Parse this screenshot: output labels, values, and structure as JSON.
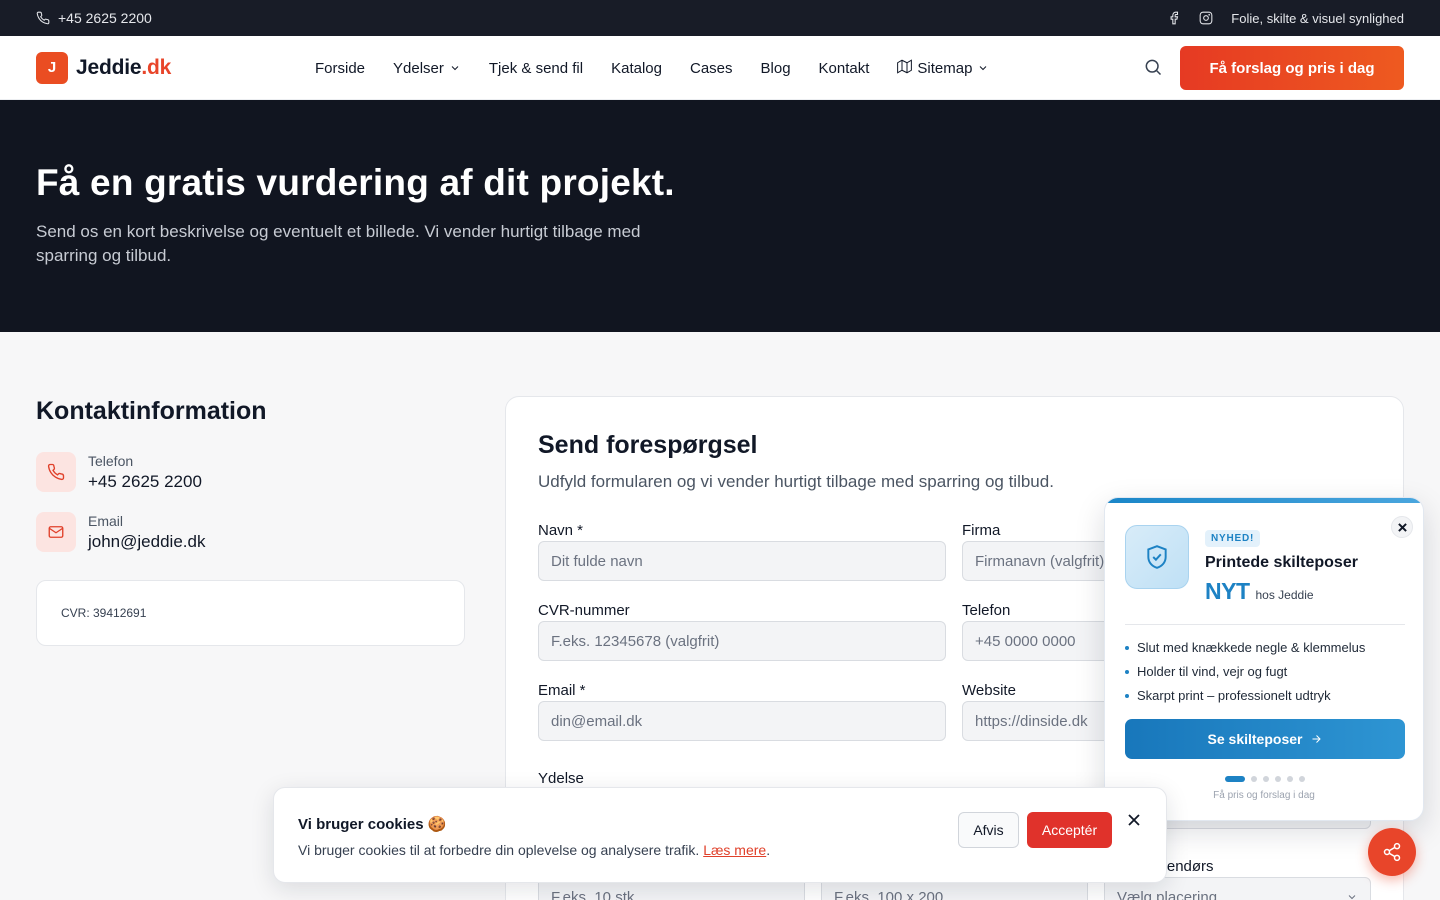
{
  "topbar": {
    "phone": "+45 2625 2200",
    "tagline": "Folie, skilte & visuel synlighed"
  },
  "header": {
    "logo_mark": "J",
    "logo_name": "Jeddie",
    "logo_tld": ".dk",
    "nav": {
      "forside": "Forside",
      "ydelser": "Ydelser",
      "tjek": "Tjek & send fil",
      "katalog": "Katalog",
      "cases": "Cases",
      "blog": "Blog",
      "kontakt": "Kontakt",
      "sitemap": "Sitemap"
    },
    "cta": "Få forslag og pris i dag"
  },
  "hero": {
    "title": "Få en gratis vurdering af dit projekt.",
    "subtitle": "Send os en kort beskrivelse og eventuelt et billede. Vi vender hurtigt tilbage med sparring og tilbud."
  },
  "contact_info": {
    "title": "Kontaktinformation",
    "phone_label": "Telefon",
    "phone_value": "+45 2625 2200",
    "email_label": "Email",
    "email_value": "john@jeddie.dk",
    "cvr": "CVR: 39412691"
  },
  "form": {
    "title": "Send forespørgsel",
    "subtitle": "Udfyld formularen og vi vender hurtigt tilbage med sparring og tilbud.",
    "name_label": "Navn *",
    "name_placeholder": "Dit fulde navn",
    "company_label": "Firma",
    "company_placeholder": "Firmanavn (valgfrit)",
    "cvr_label": "CVR-nummer",
    "cvr_placeholder": "F.eks. 12345678 (valgfrit)",
    "phone_label": "Telefon",
    "phone_placeholder": "+45 0000 0000",
    "email_label": "Email *",
    "email_placeholder": "din@email.dk",
    "website_label": "Website",
    "website_placeholder": "https://dinside.dk",
    "service_label": "Ydelse",
    "placement_label_partial": "r udendørs",
    "quantity_placeholder": "F.eks. 10 stk",
    "size_placeholder": "F.eks. 100 x 200",
    "placement_placeholder": "Vælg placering"
  },
  "promo": {
    "badge": "NYHED!",
    "title": "Printede skilteposer",
    "nyt": "NYT",
    "nyt_suffix": "hos Jeddie",
    "bullets": [
      "Slut med knækkede negle & klemmelus",
      "Holder til vind, vejr og fugt",
      "Skarpt print – professionelt udtryk"
    ],
    "button": "Se skilteposer",
    "footer": "Få pris og forslag i dag",
    "active_slide": 1,
    "slide_count": 6
  },
  "cookie": {
    "title": "Vi bruger cookies 🍪",
    "text": "Vi bruger cookies til at forbedre din oplevelse og analysere trafik.",
    "link": "Læs mere",
    "link_suffix": ".",
    "decline": "Afvis",
    "accept": "Acceptér"
  },
  "icons": {
    "phone": "phone-icon",
    "facebook": "facebook-icon",
    "instagram": "instagram-icon",
    "search": "search-icon",
    "mail": "mail-icon",
    "shield": "shield-check-icon",
    "share": "share-icon",
    "close": "close-icon",
    "map": "map-icon",
    "chevron": "chevron-down-icon",
    "arrow": "arrow-right-icon"
  },
  "colors": {
    "brand_accent": "#e8452a",
    "dark_bg": "#111520",
    "promo_blue": "#1d82c4"
  }
}
